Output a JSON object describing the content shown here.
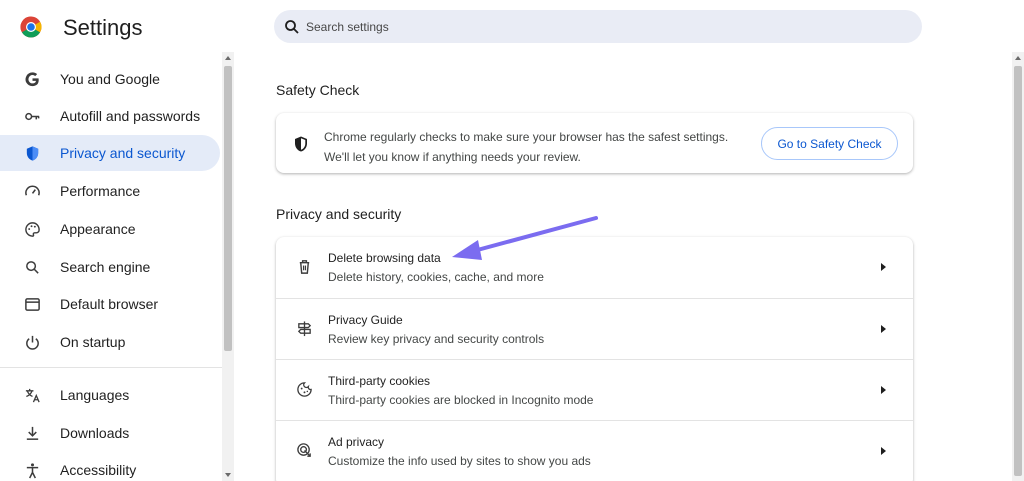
{
  "app": {
    "title": "Settings"
  },
  "search": {
    "placeholder": "Search settings"
  },
  "sidebar": {
    "items": [
      {
        "label": "You and Google",
        "icon": "google-g-icon"
      },
      {
        "label": "Autofill and passwords",
        "icon": "key-icon"
      },
      {
        "label": "Privacy and security",
        "icon": "shield-icon",
        "active": true
      },
      {
        "label": "Performance",
        "icon": "speedometer-icon"
      },
      {
        "label": "Appearance",
        "icon": "palette-icon"
      },
      {
        "label": "Search engine",
        "icon": "search-icon"
      },
      {
        "label": "Default browser",
        "icon": "browser-window-icon"
      },
      {
        "label": "On startup",
        "icon": "power-icon"
      },
      {
        "label": "Languages",
        "icon": "translate-icon"
      },
      {
        "label": "Downloads",
        "icon": "download-icon"
      },
      {
        "label": "Accessibility",
        "icon": "accessibility-icon"
      }
    ]
  },
  "safety_check": {
    "heading": "Safety Check",
    "line1": "Chrome regularly checks to make sure your browser has the safest settings.",
    "line2": "We'll let you know if anything needs your review.",
    "button": "Go to Safety Check"
  },
  "privacy": {
    "heading": "Privacy and security",
    "rows": [
      {
        "title": "Delete browsing data",
        "subtitle": "Delete history, cookies, cache, and more",
        "icon": "trash-icon"
      },
      {
        "title": "Privacy Guide",
        "subtitle": "Review key privacy and security controls",
        "icon": "signpost-icon"
      },
      {
        "title": "Third-party cookies",
        "subtitle": "Third-party cookies are blocked in Incognito mode",
        "icon": "cookie-icon"
      },
      {
        "title": "Ad privacy",
        "subtitle": "Customize the info used by sites to show you ads",
        "icon": "ad-privacy-icon"
      }
    ]
  },
  "colors": {
    "accent": "#0b57d0",
    "active_bg": "#e4ebf8",
    "search_bg": "#e9ecf5",
    "annotation": "#7b6cf0"
  }
}
